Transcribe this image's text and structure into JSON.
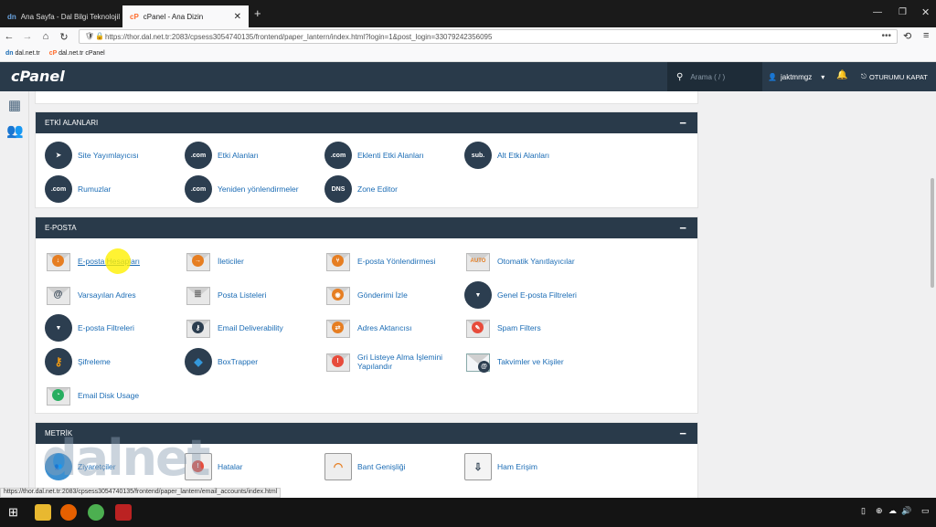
{
  "browser": {
    "tabs": [
      {
        "title": "Ana Sayfa - Dal Bilgi Teknolojil"
      },
      {
        "title": "cPanel - Ana Dizin"
      }
    ],
    "url": "https://thor.dal.net.tr:2083/cpsess3054740135/frontend/paper_lantern/index.html?login=1&post_login=33079242356095",
    "bookmarks": [
      "dal.net.tr",
      "dal.net.tr cPanel"
    ]
  },
  "header": {
    "logo": "cPanel",
    "search_placeholder": "Arama ( / )",
    "username": "jaktmmgz",
    "logout": "OTURUMU KAPAT"
  },
  "sections": {
    "domains": {
      "title": "ETKİ ALANLARI",
      "items": [
        "Site Yayımlayıcısı",
        "Etki Alanları",
        "Eklenti Etki Alanları",
        "Alt Etki Alanları",
        "Rumuzlar",
        "Yeniden yönlendirmeler",
        "Zone Editor"
      ]
    },
    "email": {
      "title": "E-POSTA",
      "items": [
        "E-posta Hesapları",
        "İleticiler",
        "E-posta Yönlendirmesi",
        "Otomatik Yanıtlayıcılar",
        "Varsayılan Adres",
        "Posta Listeleri",
        "Gönderimi İzle",
        "Genel E-posta Filtreleri",
        "E-posta Filtreleri",
        "Email Deliverability",
        "Adres Aktarıcısı",
        "Spam Filters",
        "Şifreleme",
        "BoxTrapper",
        "Gri Listeye Alma İşlemini Yapılandır",
        "Takvimler ve Kişiler",
        "Email Disk Usage"
      ]
    },
    "metrics": {
      "title": "METRİK",
      "items": [
        "Ziyaretçiler",
        "Hatalar",
        "Bant Genişliği",
        "Ham Erişim"
      ]
    }
  },
  "watermark": "dalnet",
  "status_url": "https://thor.dal.net.tr:2083/cpsess3054740135/frontend/paper_lantern/email_accounts/index.html",
  "icon_badges": {
    "com": ".com",
    "sub": "sub.",
    "dns": "DNS",
    "auto": "AUTO"
  },
  "colors": {
    "header": "#293a4a",
    "link": "#1b6cb5"
  }
}
